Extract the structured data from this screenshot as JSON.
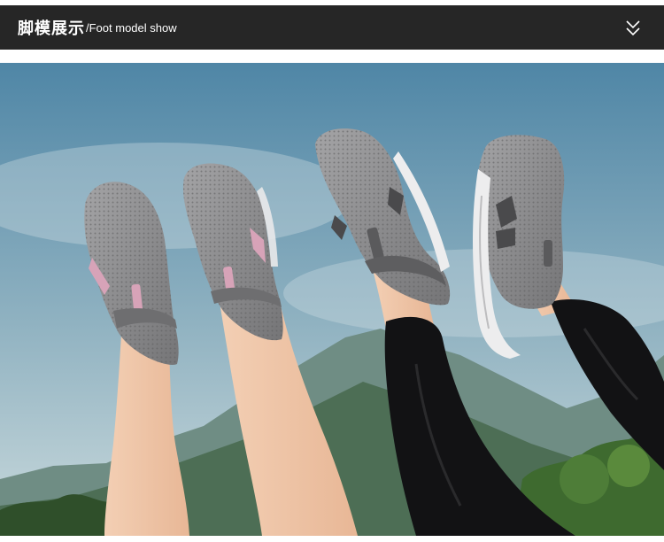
{
  "header": {
    "title_cn": "脚模展示",
    "title_en": "/Foot model show",
    "collapse_icon": "double-chevron-down-icon"
  },
  "photo": {
    "subject": "two pairs of legs wearing grey knit slip-on sneakers raised against a mountain sky",
    "colors": {
      "sky_top": "#4f86a6",
      "sky_bottom": "#c9d9dc",
      "shoe_grey": "#8a8a8c",
      "shoe_pink_accent": "#d7a3b8",
      "pants_black": "#121214",
      "skin": "#f1c7a8"
    }
  }
}
